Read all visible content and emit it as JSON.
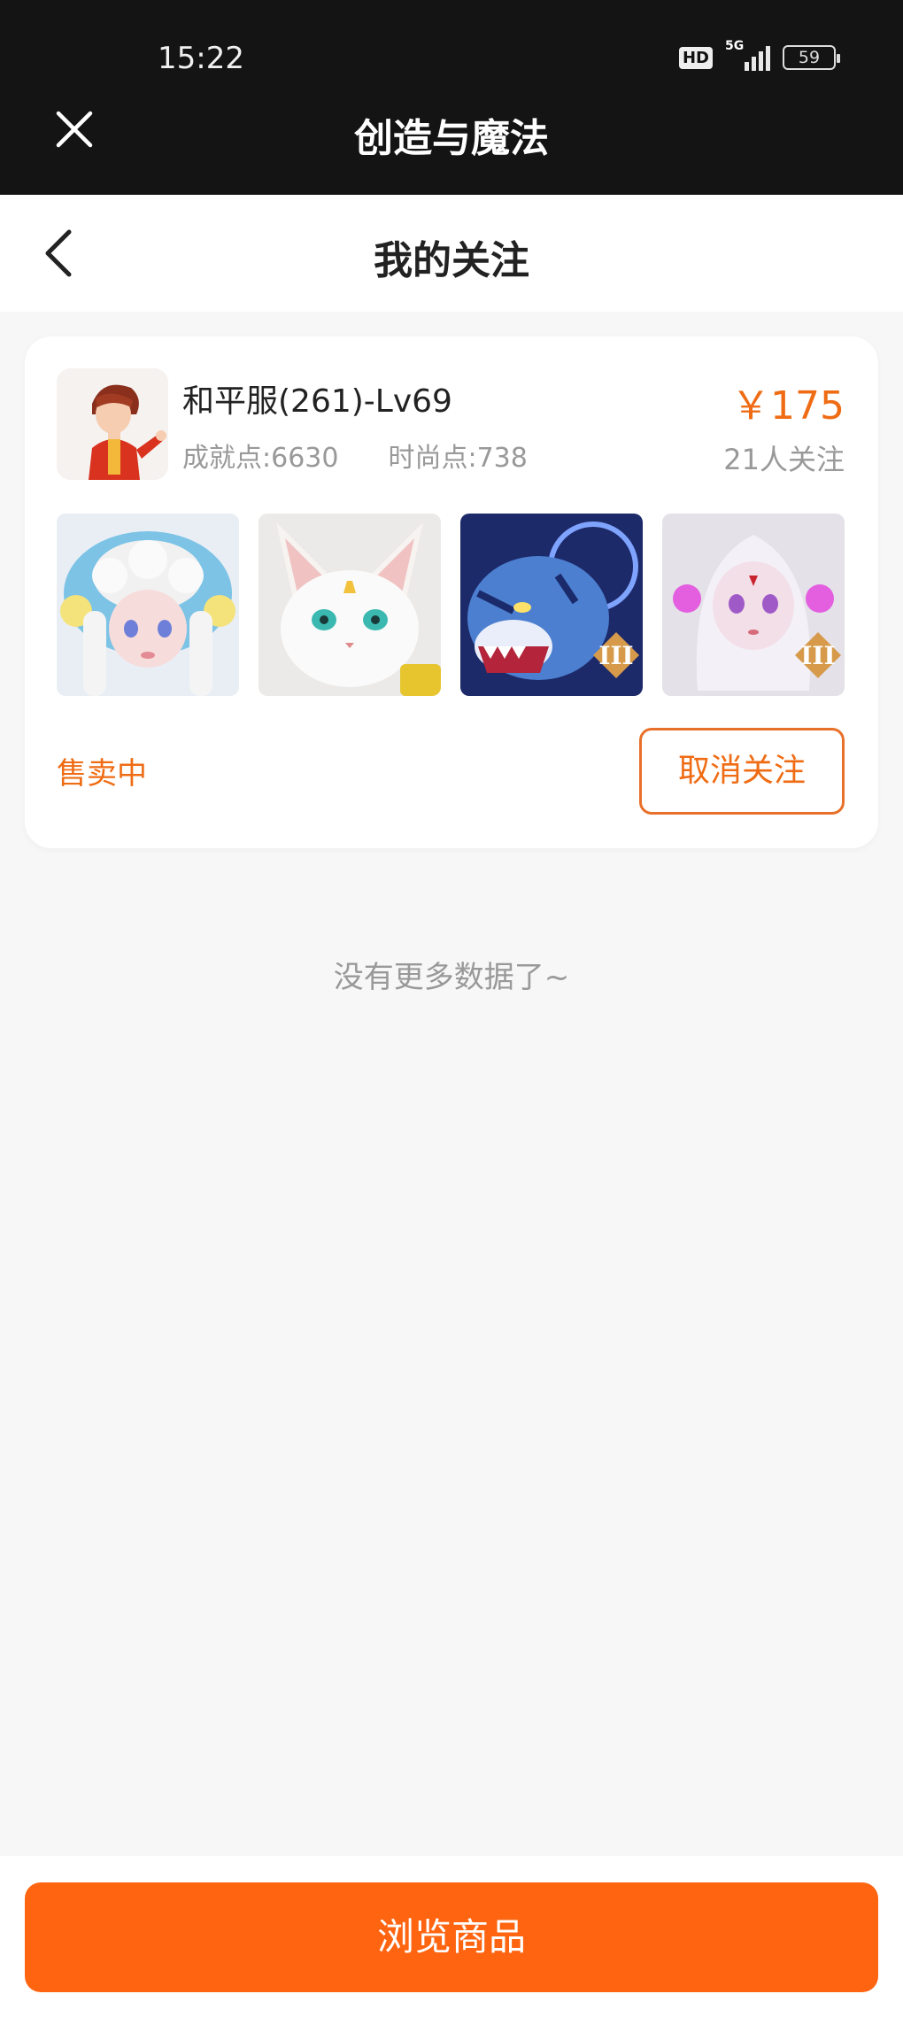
{
  "status_bar": {
    "time": "15:22",
    "hd": "HD",
    "network": "5G",
    "battery": "59"
  },
  "app_bar": {
    "title": "创造与魔法",
    "close_icon": "close-icon"
  },
  "nav": {
    "title": "我的关注",
    "back_icon": "chevron-left-icon"
  },
  "card": {
    "server_name": "和平服(261)-Lv69",
    "achievement": "成就点:6630",
    "fashion": "时尚点:738",
    "price": "￥175",
    "followers": "21人关注",
    "items": [
      {
        "name": "cloud-girl-mount"
      },
      {
        "name": "white-fox-pet"
      },
      {
        "name": "blue-tiger-mount",
        "badge": "III"
      },
      {
        "name": "moon-fairy-pet",
        "badge": "III"
      }
    ],
    "sale_status": "售卖中",
    "unfollow_label": "取消关注"
  },
  "end_message": "没有更多数据了~",
  "bottom": {
    "browse_label": "浏览商品"
  },
  "colors": {
    "accent": "#ff6410",
    "accent_text": "#ef6c14",
    "topbar": "#141414"
  }
}
